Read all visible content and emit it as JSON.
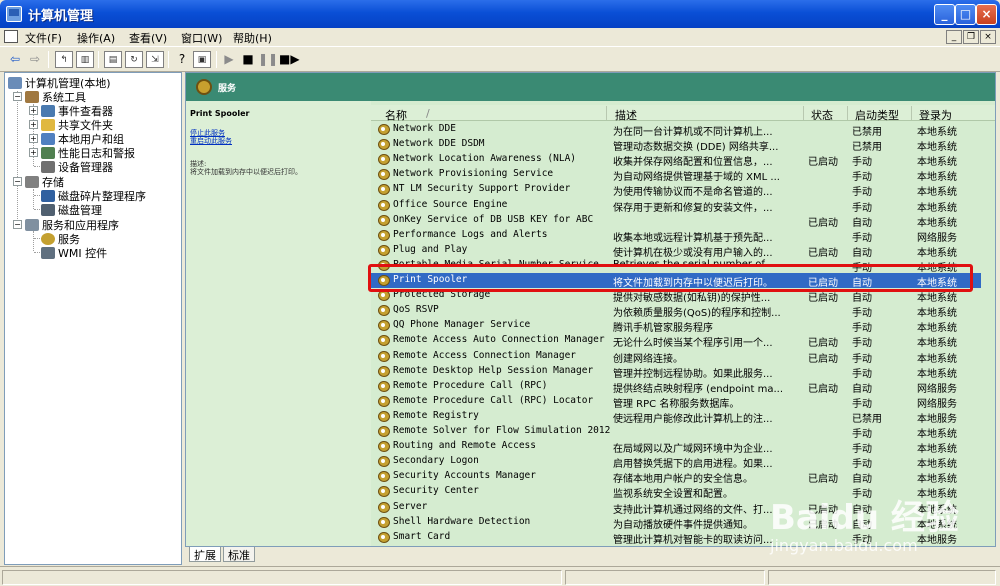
{
  "window": {
    "title": "计算机管理",
    "controls": {
      "minimize": "_",
      "maximize": "□",
      "close": "×"
    }
  },
  "menu": {
    "items": [
      "文件(F)",
      "操作(A)",
      "查看(V)",
      "窗口(W)",
      "帮助(H)"
    ],
    "mdi_controls": [
      "_",
      "❐",
      "×"
    ]
  },
  "toolbar": {
    "icons": [
      "back-icon",
      "forward-icon",
      "up-folder-icon",
      "show-hide-tree-icon",
      "properties-icon",
      "refresh-icon",
      "export-list-icon",
      "help-icon",
      "console-icon",
      "start-service-icon",
      "stop-service-icon",
      "pause-service-icon",
      "restart-service-icon"
    ]
  },
  "tree": {
    "items": [
      {
        "label": "计算机管理(本地)",
        "level": 0,
        "expander": "",
        "color": "#6A8CB8"
      },
      {
        "label": "系统工具",
        "level": 1,
        "expander": "−",
        "color": "#A07840"
      },
      {
        "label": "事件查看器",
        "level": 2,
        "expander": "+",
        "color": "#4A7AB0"
      },
      {
        "label": "共享文件夹",
        "level": 2,
        "expander": "+",
        "color": "#E0B840"
      },
      {
        "label": "本地用户和组",
        "level": 2,
        "expander": "+",
        "color": "#5080C0"
      },
      {
        "label": "性能日志和警报",
        "level": 2,
        "expander": "+",
        "color": "#508050"
      },
      {
        "label": "设备管理器",
        "level": 2,
        "expander": "",
        "color": "#707070"
      },
      {
        "label": "存储",
        "level": 1,
        "expander": "−",
        "color": "#808080"
      },
      {
        "label": "磁盘碎片整理程序",
        "level": 2,
        "expander": "",
        "color": "#3060A0"
      },
      {
        "label": "磁盘管理",
        "level": 2,
        "expander": "",
        "color": "#506070"
      },
      {
        "label": "服务和应用程序",
        "level": 1,
        "expander": "−",
        "color": "#8090A0"
      },
      {
        "label": "服务",
        "level": 2,
        "expander": "",
        "color": "#C4A030"
      },
      {
        "label": "WMI 控件",
        "level": 2,
        "expander": "",
        "color": "#607080"
      }
    ]
  },
  "header": {
    "title": "服务"
  },
  "description": {
    "service_name": "Print Spooler",
    "links": [
      "停止此服务",
      "重启动此服务"
    ],
    "label": "描述:",
    "text": "将文件加载到内存中以便迟后打印。"
  },
  "columns": {
    "name": "名称",
    "sort_arrow": "/",
    "desc": "描述",
    "status": "状态",
    "startup": "启动类型",
    "logon": "登录为"
  },
  "services": [
    {
      "name": "Network DDE",
      "desc": "为在同一台计算机或不同计算机上...",
      "status": "",
      "startup": "已禁用",
      "logon": "本地系统"
    },
    {
      "name": "Network DDE DSDM",
      "desc": "管理动态数据交换 (DDE) 网络共享...",
      "status": "",
      "startup": "已禁用",
      "logon": "本地系统"
    },
    {
      "name": "Network Location Awareness (NLA)",
      "desc": "收集并保存网络配置和位置信息，...",
      "status": "已启动",
      "startup": "手动",
      "logon": "本地系统"
    },
    {
      "name": "Network Provisioning Service",
      "desc": "为自动网络提供管理基于域的 XML ...",
      "status": "",
      "startup": "手动",
      "logon": "本地系统"
    },
    {
      "name": "NT LM Security Support Provider",
      "desc": "为使用传输协议而不是命名管道的...",
      "status": "",
      "startup": "手动",
      "logon": "本地系统"
    },
    {
      "name": "Office Source Engine",
      "desc": "保存用于更新和修复的安装文件，...",
      "status": "",
      "startup": "手动",
      "logon": "本地系统"
    },
    {
      "name": "OnKey Service of DB USB KEY for ABC",
      "desc": "",
      "status": "已启动",
      "startup": "自动",
      "logon": "本地系统"
    },
    {
      "name": "Performance Logs and Alerts",
      "desc": "收集本地或远程计算机基于预先配...",
      "status": "",
      "startup": "手动",
      "logon": "网络服务"
    },
    {
      "name": "Plug and Play",
      "desc": "使计算机在极少或没有用户输入的...",
      "status": "已启动",
      "startup": "自动",
      "logon": "本地系统"
    },
    {
      "name": "Portable Media Serial Number Service",
      "desc": "Retrieves the serial number of...",
      "status": "",
      "startup": "手动",
      "logon": "本地系统"
    },
    {
      "name": "Print Spooler",
      "desc": "将文件加载到内存中以便迟后打印。",
      "status": "已启动",
      "startup": "自动",
      "logon": "本地系统",
      "selected": true
    },
    {
      "name": "Protected Storage",
      "desc": "提供对敏感数据(如私钥)的保护性...",
      "status": "已启动",
      "startup": "自动",
      "logon": "本地系统"
    },
    {
      "name": "QoS RSVP",
      "desc": "为依赖质量服务(QoS)的程序和控制...",
      "status": "",
      "startup": "手动",
      "logon": "本地系统"
    },
    {
      "name": "QQ Phone Manager Service",
      "desc": "腾讯手机管家服务程序",
      "status": "",
      "startup": "手动",
      "logon": "本地系统"
    },
    {
      "name": "Remote Access Auto Connection Manager",
      "desc": "无论什么时候当某个程序引用一个...",
      "status": "已启动",
      "startup": "手动",
      "logon": "本地系统"
    },
    {
      "name": "Remote Access Connection Manager",
      "desc": "创建网络连接。",
      "status": "已启动",
      "startup": "手动",
      "logon": "本地系统"
    },
    {
      "name": "Remote Desktop Help Session Manager",
      "desc": "管理并控制远程协助。如果此服务...",
      "status": "",
      "startup": "手动",
      "logon": "本地系统"
    },
    {
      "name": "Remote Procedure Call (RPC)",
      "desc": "提供终结点映射程序 (endpoint ma...",
      "status": "已启动",
      "startup": "自动",
      "logon": "网络服务"
    },
    {
      "name": "Remote Procedure Call (RPC) Locator",
      "desc": "管理 RPC 名称服务数据库。",
      "status": "",
      "startup": "手动",
      "logon": "网络服务"
    },
    {
      "name": "Remote Registry",
      "desc": "使远程用户能修改此计算机上的注...",
      "status": "",
      "startup": "已禁用",
      "logon": "本地服务"
    },
    {
      "name": "Remote Solver for Flow Simulation 2012",
      "desc": "",
      "status": "",
      "startup": "手动",
      "logon": "本地系统"
    },
    {
      "name": "Routing and Remote Access",
      "desc": "在局域网以及广域网环境中为企业...",
      "status": "",
      "startup": "手动",
      "logon": "本地系统"
    },
    {
      "name": "Secondary Logon",
      "desc": "启用替换凭据下的启用进程。如果...",
      "status": "",
      "startup": "手动",
      "logon": "本地系统"
    },
    {
      "name": "Security Accounts Manager",
      "desc": "存储本地用户帐户的安全信息。",
      "status": "已启动",
      "startup": "自动",
      "logon": "本地系统"
    },
    {
      "name": "Security Center",
      "desc": "监视系统安全设置和配置。",
      "status": "",
      "startup": "手动",
      "logon": "本地系统"
    },
    {
      "name": "Server",
      "desc": "支持此计算机通过网络的文件、打...",
      "status": "已启动",
      "startup": "自动",
      "logon": "本地系统"
    },
    {
      "name": "Shell Hardware Detection",
      "desc": "为自动播放硬件事件提供通知。",
      "status": "已启动",
      "startup": "自动",
      "logon": "本地系统"
    },
    {
      "name": "Smart Card",
      "desc": "管理此计算机对智能卡的取读访问...",
      "status": "",
      "startup": "手动",
      "logon": "本地服务"
    }
  ],
  "tabs": [
    "扩展",
    "标准"
  ],
  "watermark": {
    "logo": "Baidu 经验",
    "site": "jingyan.baidu.com"
  },
  "colors": {
    "selection": "#316AC5",
    "highlight": "#E01010",
    "list_bg": "#D5ECD0",
    "header_band": "#3A8A73"
  }
}
